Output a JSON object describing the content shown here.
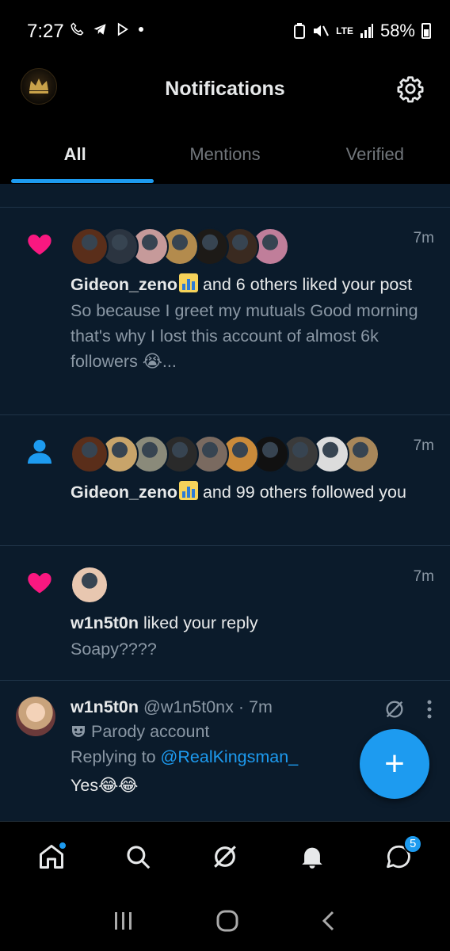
{
  "status_bar": {
    "time": "7:27",
    "network": "LTE",
    "battery": "58%"
  },
  "header": {
    "title": "Notifications",
    "avatar_alt": "KINGSMAN"
  },
  "tabs": [
    {
      "label": "All",
      "active": true
    },
    {
      "label": "Mentions",
      "active": false
    },
    {
      "label": "Verified",
      "active": false
    }
  ],
  "notifications": [
    {
      "type": "like",
      "time": "7m",
      "actor": "Gideon_zeno",
      "rest": " and 6 others liked your post",
      "preview": "So because I greet my mutuals Good morning that's why I lost this account of almost 6k followers 😭...",
      "avatar_colors": [
        "#5a2e1a",
        "#2b3440",
        "#c69a9a",
        "#b38b4d",
        "#1d1a17",
        "#3a2a20",
        "#c07e9a"
      ]
    },
    {
      "type": "follow",
      "time": "7m",
      "actor": "Gideon_zeno",
      "rest": " and 99 others followed you",
      "avatar_colors": [
        "#5a2e1a",
        "#c8a46a",
        "#8a8a7a",
        "#2a2a2a",
        "#7a6a60",
        "#c98a3a",
        "#111111",
        "#3a3a3a",
        "#dcdcdc",
        "#a8875a"
      ]
    },
    {
      "type": "like",
      "time": "7m",
      "actor": "w1n5t0n",
      "rest": " liked your reply",
      "preview": "Soapy????",
      "avatar_colors": [
        "#e8c7b0"
      ]
    }
  ],
  "reply": {
    "name": "w1n5t0n",
    "handle": "@w1n5t0nx · 7m",
    "label": "Parody account",
    "replying_prefix": "Replying to ",
    "replying_to": "@RealKingsman_",
    "body": "Yes😂😂"
  },
  "fab": {
    "label": "+"
  },
  "bottom_nav": {
    "messages_badge": "5"
  },
  "colors": {
    "accent": "#1d9bf0",
    "like": "#f91880",
    "feed_bg": "#0b1b2b"
  }
}
